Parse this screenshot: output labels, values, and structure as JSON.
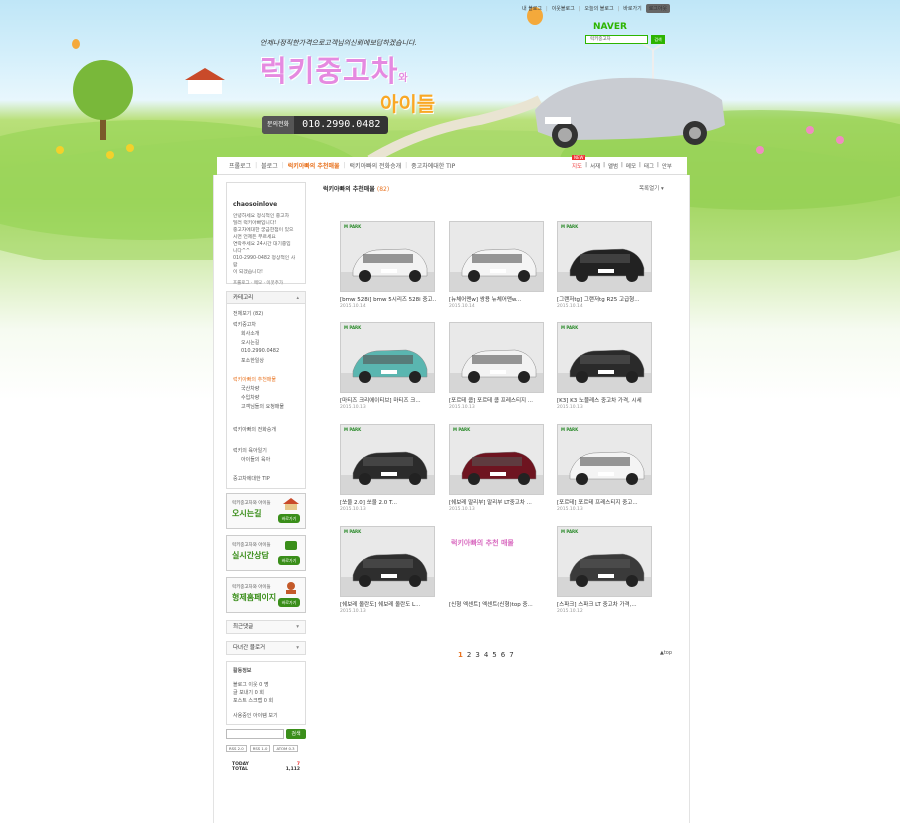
{
  "top_links": [
    "내 블로그",
    "이웃블로그",
    "오늘의 블로그",
    "바로가기"
  ],
  "logout": "로그아웃",
  "naver_logo": "NAVER",
  "naver_search": {
    "placeholder": "럭키중고차",
    "go": "검색"
  },
  "header": {
    "slogan": "언제나정직한가격으로고객님의신뢰에보답하겠습니다.",
    "title": "럭키중고차",
    "title_suffix": "와",
    "title2": "아이들",
    "phone_label": "문의전화",
    "phone": "010.2990.0482"
  },
  "nav": {
    "items": [
      "프롤로그",
      "블로그",
      "럭키아빠의 추천매물",
      "럭키아빠의 전화승개",
      "중고차에대한 TIP"
    ],
    "right": [
      "지도",
      "서재",
      "앨범",
      "메모",
      "태그",
      "안부"
    ],
    "new_badge": "NEW"
  },
  "profile": {
    "name": "chaosoinlove",
    "desc": [
      "안녕하세요 정식적인 중고차",
      "딜러 럭키아빠입니다!",
      "중고차에대한 궁금한점이 있으",
      "시면 언제든 부르세요",
      "연락주세요 24시간 대기중입",
      "니다^^",
      "010-2990-0482 정상적인 사람",
      "이 되겠습니다!"
    ],
    "links": "프롤로그 · 메모 · 이웃추가"
  },
  "categories": {
    "title": "카테고리",
    "items": [
      "전체보기 (82)",
      "럭키중고차",
      "회사소개",
      "오시는길",
      "010.2990.0482",
      "포소한일상",
      "럭키아빠의 추천매물",
      "국산차량",
      "수입차량",
      "고객님들의 요청매물",
      "럭키아빠의 전화승개",
      "럭키의 육아일기",
      "아이들의 육아",
      "중고차에대한 TIP"
    ]
  },
  "banners": [
    {
      "line1": "럭키중고차와 아이들",
      "line2": "오시는길",
      "go": "바로가기"
    },
    {
      "line1": "럭키중고차와 아이들",
      "line2": "실시간상담",
      "go": "바로가기"
    },
    {
      "line1": "럭키중고차와 아이들",
      "line2": "형제홈페이지",
      "go": "바로가기"
    }
  ],
  "sidebar_sections": [
    "최근댓글",
    "다녀간 블로거"
  ],
  "activity": {
    "title": "활동정보",
    "lines": [
      "블로그 이웃 0 명",
      "글 보내기 0 회",
      "포스트 스크랩 0 회"
    ],
    "footer": "사용중인 아이템 보기"
  },
  "sidebar_search_btn": "검색",
  "rss": [
    "RSS 2.0",
    "RSS 1.0",
    "ATOM 0.3"
  ],
  "counter": {
    "today_label": "TODAY",
    "today": "7",
    "total_label": "TOTAL",
    "total": "1,112"
  },
  "main": {
    "title": "럭키아빠의 추천매물",
    "count": "(82)",
    "list_toggle": "목록열기",
    "cards": [
      {
        "caption": "[bmw 528i] bmw 5시리즈 528i 중고...",
        "date": "2015.10.14",
        "watermark": "M PARK",
        "color": "#f2f2f2"
      },
      {
        "caption": "[뉴체어맨w] 쌍용 뉴체어맨w...",
        "date": "2015.10.14",
        "watermark": "",
        "color": "#f4f4f4"
      },
      {
        "caption": "[그랜저tg] 그랜저tg R25 고급형...",
        "date": "2015.10.14",
        "watermark": "M PARK",
        "color": "#222222"
      },
      {
        "caption": "[마티즈 크리에이티브] 마티즈 크...",
        "date": "2015.10.13",
        "watermark": "M PARK",
        "color": "#5ab6b0"
      },
      {
        "caption": "[포르테 쿱] 포르테 쿱 프레스티지 ...",
        "date": "2015.10.13",
        "watermark": "",
        "color": "#f2f2f2"
      },
      {
        "caption": "[K3] K3 노블레스 중고차 가격, 시세",
        "date": "2015.10.13",
        "watermark": "M PARK",
        "color": "#2a2a2a"
      },
      {
        "caption": "[쏘울 2.0] 쏘울 2.0 T...",
        "date": "2015.10.13",
        "watermark": "M PARK",
        "color": "#2b2b2b"
      },
      {
        "caption": "[쉐보레 말리부] 말리부 LT중고차 ...",
        "date": "2015.10.13",
        "watermark": "M PARK",
        "color": "#6e1420"
      },
      {
        "caption": "[포르테] 포르테 프레스티지 중고...",
        "date": "2015.10.13",
        "watermark": "M PARK",
        "color": "#f4f4f4"
      },
      {
        "caption": "[쉐보레 올란도] 쉐보레 올란도 L...",
        "date": "2015.10.13",
        "watermark": "M PARK",
        "color": "#2e2e2e"
      },
      {
        "caption": "[신형 엑센트] 엑센트(신형)top 중...",
        "date": "",
        "watermark": "",
        "color": "",
        "special": "럭키아빠의 추천 매물"
      },
      {
        "caption": "[스파크] 스파크 LT 중고차 가격,...",
        "date": "2015.10.12",
        "watermark": "M PARK",
        "color": "#3a3a3a"
      }
    ]
  },
  "pager": [
    "1",
    "2",
    "3",
    "4",
    "5",
    "6",
    "7"
  ],
  "top_link": "▲top"
}
